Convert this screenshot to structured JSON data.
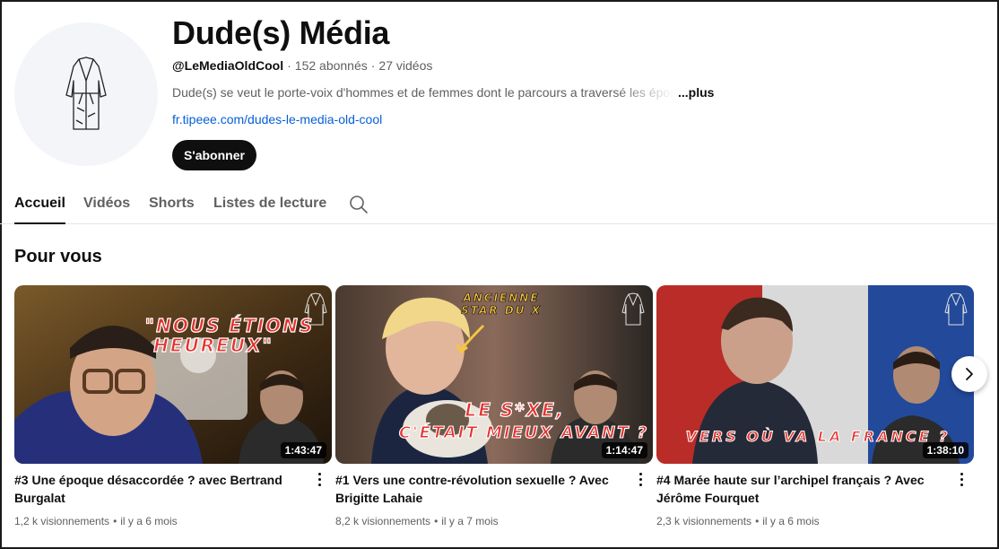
{
  "channel": {
    "name": "Dude(s) Média",
    "handle": "@LeMediaOldCool",
    "subscribers": "152 abonnés",
    "videos_count": "27 vidéos",
    "description": "Dude(s) se veut le porte-voix d'hommes et de femmes dont le parcours a traversé les époq",
    "more_label": "...plus",
    "link": "fr.tipeee.com/dudes-le-media-old-cool",
    "subscribe_label": "S'abonner",
    "avatar_icon": "bathrobe-icon"
  },
  "tabs": [
    {
      "label": "Accueil",
      "active": true
    },
    {
      "label": "Vidéos",
      "active": false
    },
    {
      "label": "Shorts",
      "active": false
    },
    {
      "label": "Listes de lecture",
      "active": false
    }
  ],
  "section": {
    "title": "Pour vous"
  },
  "videos": [
    {
      "duration": "1:43:47",
      "title": "#3 Une époque désaccordée ? avec Bertrand Burgalat",
      "views": "1,2 k visionnements",
      "age": "il y a 6 mois",
      "overlay_text": [
        "\"NOUS ÉTIONS",
        "HEUREUX\""
      ]
    },
    {
      "duration": "1:14:47",
      "title": "#1 Vers une contre-révolution sexuelle ? Avec Brigitte Lahaie",
      "views": "8,2 k visionnements",
      "age": "il y a 7 mois",
      "overlay_text": [
        "ANCIENNE",
        "STAR DU X",
        "LE S*XE,",
        "C'ÉTAIT MIEUX AVANT ?"
      ]
    },
    {
      "duration": "1:38:10",
      "title": "#4 Marée haute sur l’archipel français ? Avec Jérôme Fourquet",
      "views": "2,3 k visionnements",
      "age": "il y a 6 mois",
      "overlay_text": [
        "VERS OÙ VA LA FRANCE ?"
      ]
    }
  ],
  "colors": {
    "accent_link": "#065fd4",
    "subscribe_bg": "#0f0f0f",
    "overlay_text": "#e5322d"
  }
}
